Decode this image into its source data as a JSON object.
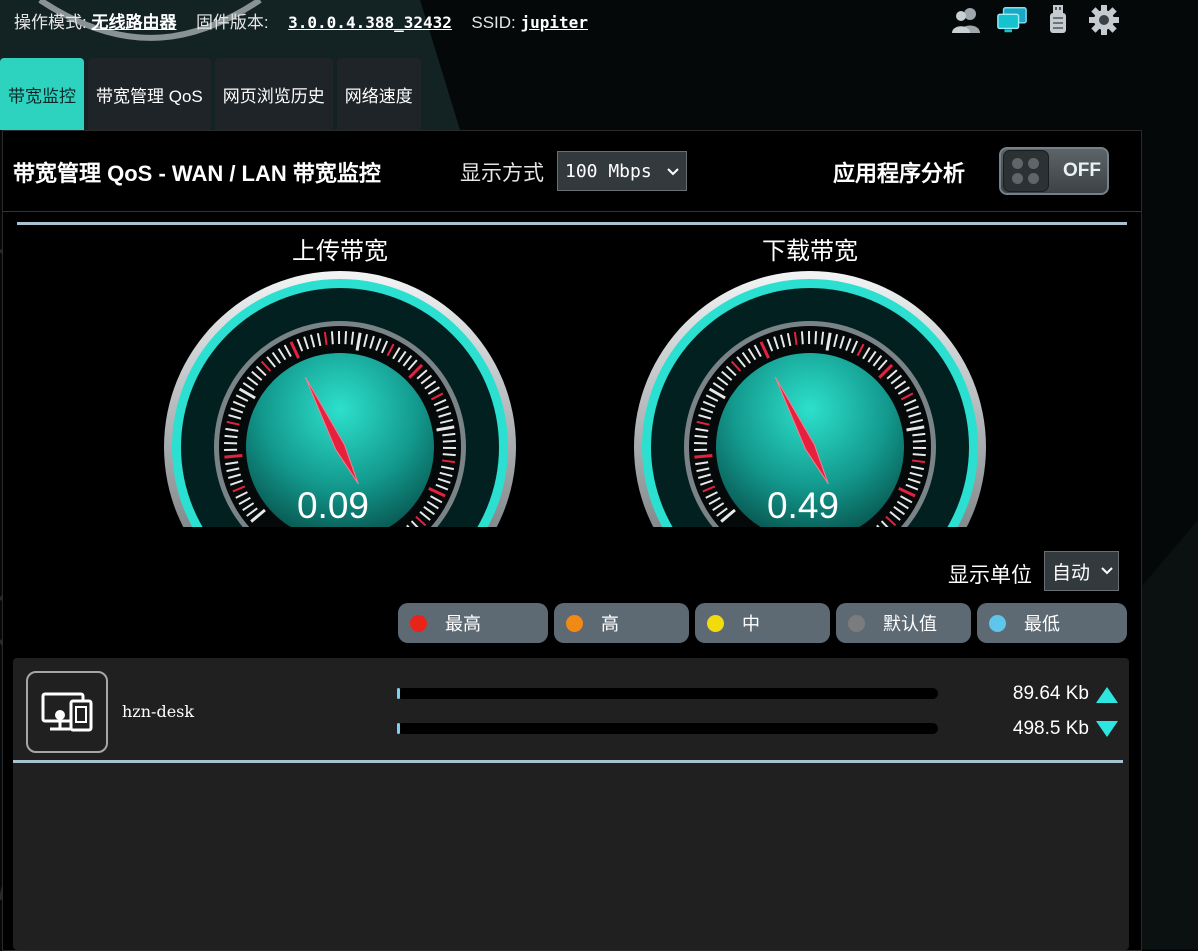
{
  "topbar": {
    "mode_label": "操作模式:",
    "mode_value": "无线路由器",
    "firmware_label": "固件版本:",
    "firmware_value": "3.0.0.4.388_32432",
    "ssid_label": "SSID:",
    "ssid_value": "jupiter",
    "icons": [
      "users-icon",
      "network-map-icon",
      "usb-icon",
      "settings-icon"
    ]
  },
  "tabs": [
    {
      "label": "带宽监控",
      "active": true
    },
    {
      "label": "带宽管理 QoS",
      "active": false
    },
    {
      "label": "网页浏览历史",
      "active": false
    },
    {
      "label": "网络速度",
      "active": false
    }
  ],
  "header": {
    "title": "带宽管理 QoS - WAN / LAN 带宽监控",
    "display_mode_label": "显示方式",
    "display_mode_value": "100 Mbps",
    "app_analysis_label": "应用程序分析",
    "app_analysis_toggle": "OFF"
  },
  "gauges": {
    "upload": {
      "title": "上传带宽",
      "value": "0.09",
      "reading": 0.09
    },
    "download": {
      "title": "下载带宽",
      "value": "0.49",
      "reading": 0.49
    }
  },
  "unit": {
    "label": "显示单位",
    "value": "自动"
  },
  "legend": [
    {
      "label": "最高",
      "color": "#e8231a"
    },
    {
      "label": "高",
      "color": "#f08a14"
    },
    {
      "label": "中",
      "color": "#f2db0c"
    },
    {
      "label": "默认值",
      "color": "#7c7c7c"
    },
    {
      "label": "最低",
      "color": "#5dc6ea"
    }
  ],
  "clients": [
    {
      "name": "hzn-desk",
      "upload": "89.64 Kb",
      "download": "498.5 Kb"
    }
  ],
  "colors": {
    "accent": "#2ed3c0",
    "panel_bg": "#000000",
    "pill_bg": "#5d6a74"
  }
}
